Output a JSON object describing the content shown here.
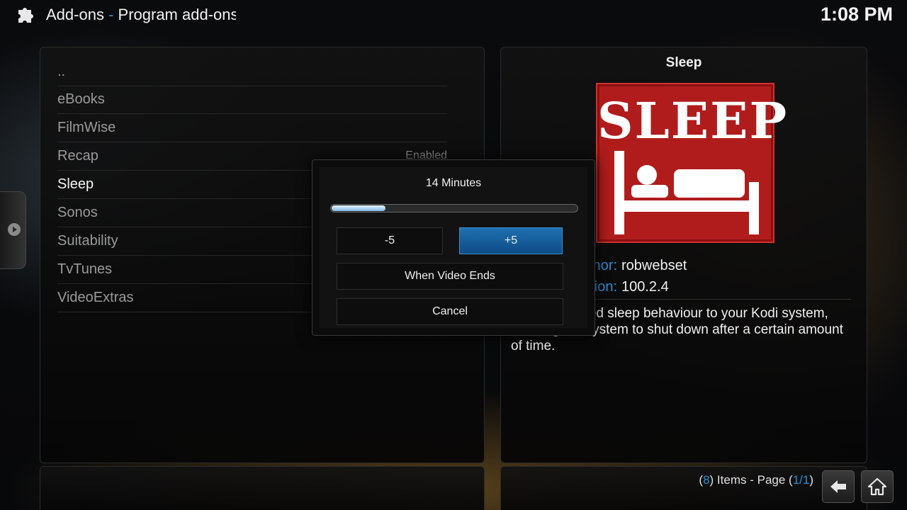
{
  "header": {
    "section": "Add-ons",
    "separator": " - ",
    "subtitle": "Program add-ons",
    "clock": "1:08 PM"
  },
  "list": {
    "items": [
      {
        "label": "..",
        "status": ""
      },
      {
        "label": "eBooks",
        "status": ""
      },
      {
        "label": "FilmWise",
        "status": ""
      },
      {
        "label": "Recap",
        "status": "Enabled"
      },
      {
        "label": "Sleep",
        "status": ""
      },
      {
        "label": "Sonos",
        "status": ""
      },
      {
        "label": "Suitability",
        "status": ""
      },
      {
        "label": "TvTunes",
        "status": ""
      },
      {
        "label": "VideoExtras",
        "status": ""
      }
    ],
    "selected_index": 4
  },
  "info": {
    "title": "Sleep",
    "logo_text": "SLEEP",
    "author_key": "Author:",
    "author": "robwebset",
    "version_key": "Version:",
    "version": "100.2.4",
    "description": "Adds advanced sleep behaviour to your Kodi system, allowing the system to shut down after a certain amount of time."
  },
  "footer": {
    "count_prefix": "(",
    "count": "8",
    "count_suffix": ") Items - Page (",
    "page": "1/1",
    "page_suffix": ")"
  },
  "dialog": {
    "title": "14 Minutes",
    "progress_fraction": 0.22,
    "minus_label": "-5",
    "plus_label": "+5",
    "video_label": "When Video Ends",
    "cancel_label": "Cancel"
  },
  "icons": {
    "header": "puzzle-piece-icon",
    "back": "back-arrow-icon",
    "home": "home-icon",
    "side": "chevron-right-icon"
  },
  "colors": {
    "accent": "#2a8fd6",
    "logo_red": "#b01c1c",
    "focus_blue": "#1f6fb0"
  }
}
